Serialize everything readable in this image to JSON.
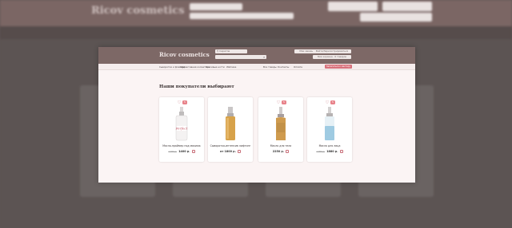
{
  "brand": {
    "logo": "Ricov cosmetics"
  },
  "header": {
    "city": "Саратов",
    "search_placeholder": "",
    "button_1": "Мои заказы",
    "button_2": "Войти/Зарегистрироваться",
    "button_3": "Моя корзина · 0 товаров"
  },
  "nav": {
    "items": [
      "Сыворотки и флюиды",
      "Эффективная косметика",
      "Красивые ногти",
      "Wellness"
    ],
    "secondary": [
      "Все товары",
      "Контакты",
      "Оплата"
    ],
    "cta": "Записаться к мастеру"
  },
  "section": {
    "title": "Наши покупатели выбирают"
  },
  "products": [
    {
      "name": "Масло-праймер под макияж",
      "old_price": "1 490 р.",
      "price": "1400 р.",
      "badge": "5",
      "bottle_color": "#f4f2f2",
      "label_text": "Perfect"
    },
    {
      "name": "Сыворотка-интенсив лифтинг",
      "old_price": "",
      "price": "от 1800 р.",
      "badge": "",
      "bottle_color": "#d7a24a",
      "label_text": ""
    },
    {
      "name": "Масло для тела",
      "old_price": "",
      "price": "2250 р.",
      "badge": "5",
      "bottle_color": "#cf9b4e",
      "label_text": ""
    },
    {
      "name": "Масло для лица",
      "old_price": "1 990 р.",
      "price": "1880 р.",
      "badge": "5",
      "bottle_color": "#9fcbe2",
      "label_text": ""
    }
  ],
  "colors": {
    "accent": "#d8707a",
    "header_bg": "#7d6866",
    "modal_bg": "#fbf4f4"
  }
}
